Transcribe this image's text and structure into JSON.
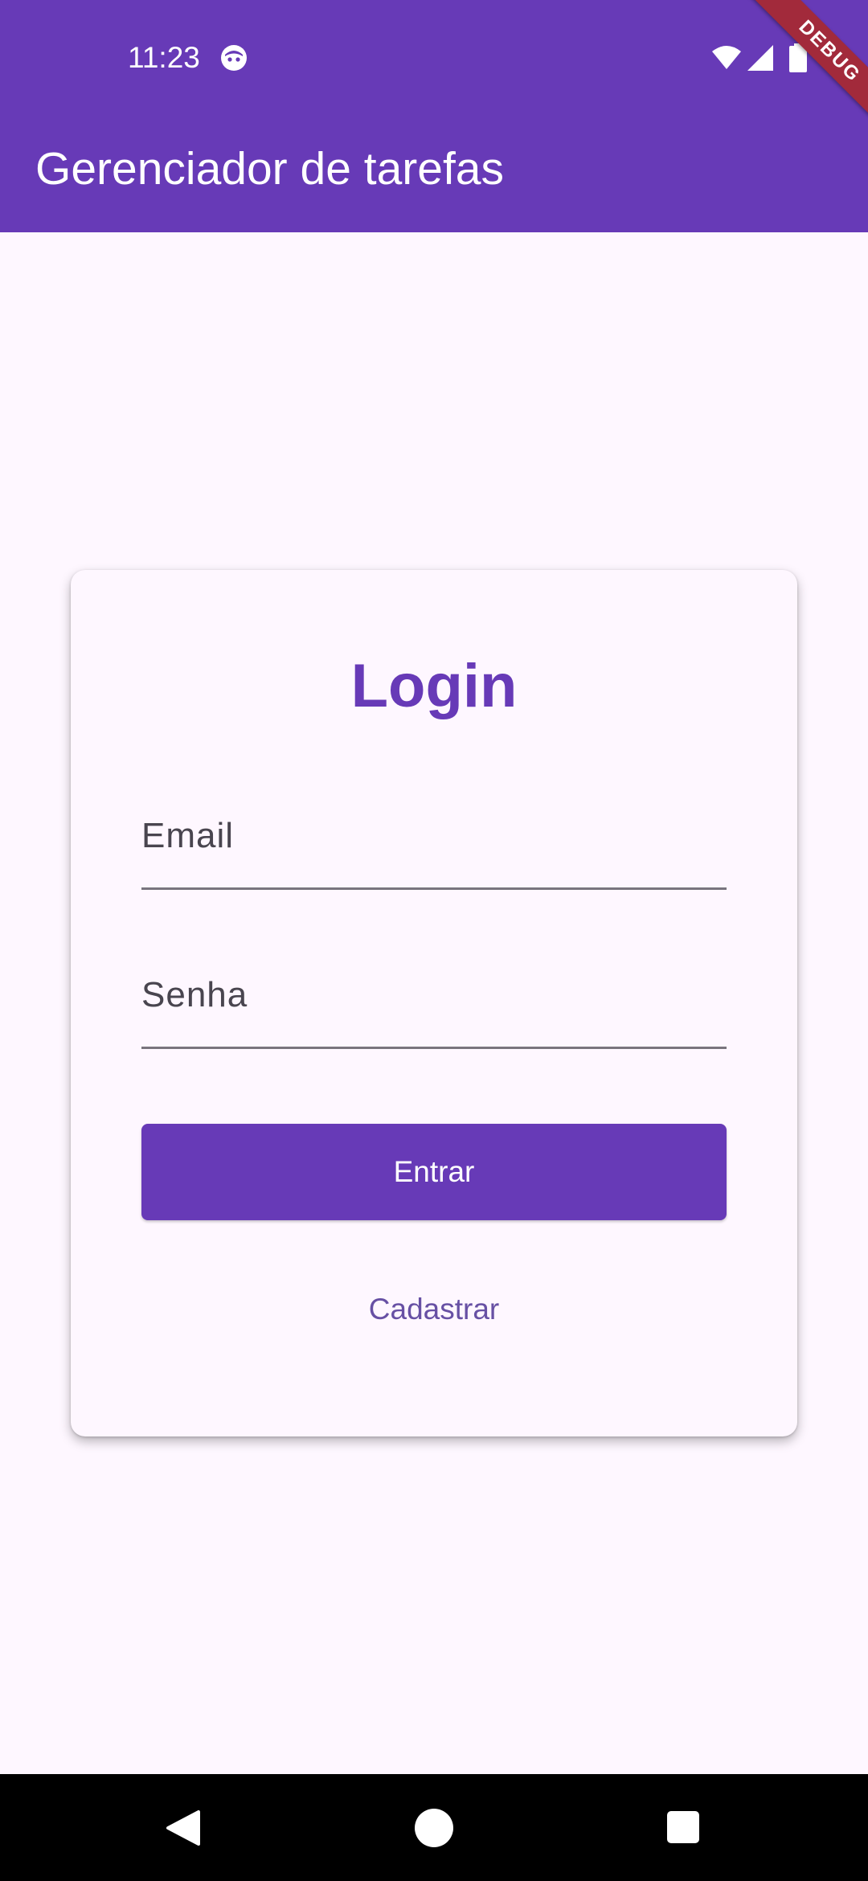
{
  "status_bar": {
    "time": "11:23",
    "icons": [
      "notification-face-icon",
      "wifi-icon",
      "signal-icon",
      "battery-icon"
    ]
  },
  "debug_banner": {
    "label": "DEBUG",
    "color": "#A22A3B"
  },
  "app_bar": {
    "title": "Gerenciador de tarefas",
    "color": "#673AB7"
  },
  "login_card": {
    "title": "Login",
    "email_label": "Email",
    "password_label": "Senha",
    "submit_label": "Entrar",
    "register_label": "Cadastrar"
  },
  "nav_bar": {
    "icons": [
      "back-icon",
      "home-icon",
      "recent-apps-icon"
    ]
  },
  "colors": {
    "primary": "#673AB7",
    "background": "#FEF7FF",
    "text_button": "#6750A4",
    "field_label": "#49454F",
    "underline": "#79747E"
  }
}
